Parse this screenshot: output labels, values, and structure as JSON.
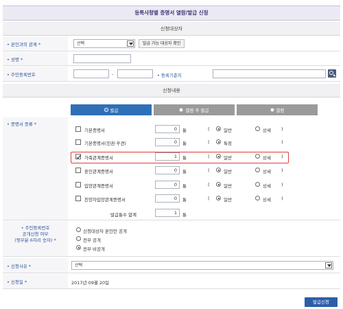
{
  "title": "등록사항별 증명서 열람/발급 신청",
  "sections": {
    "applicant_header": "신청대상자",
    "content_header": "신청내용"
  },
  "applicant": {
    "relation_label": "• 본인과의 관계 *",
    "relation_value": "선택",
    "check_button": "발급 가능 대상자 확인",
    "name_label": "• 성명 *",
    "rrn_label": "• 주민등록번호",
    "rrn_dash": "-",
    "reg_base_label": "• 등록기준지"
  },
  "tabs": [
    {
      "label": "발급",
      "selected": true
    },
    {
      "label": "열람 후 발급",
      "selected": false
    },
    {
      "label": "열람",
      "selected": false
    }
  ],
  "cert_label": "• 증명서 종류 *",
  "certs": [
    {
      "name": "기본증명서",
      "checked": false,
      "qty": "0",
      "unit": "통",
      "open": "(",
      "r1": "일반",
      "r2": "상세",
      "close": ")",
      "r1_on": true
    },
    {
      "name": "기본증명서(친권·후견)",
      "checked": false,
      "qty": "0",
      "unit": "통",
      "open": "(",
      "r1": "특정",
      "r2": "",
      "close": ")",
      "r1_on": true
    },
    {
      "name": "가족관계증명서",
      "checked": true,
      "qty": "1",
      "unit": "통",
      "open": "(",
      "r1": "일반",
      "r2": "상세",
      "close": ")",
      "r1_on": true
    },
    {
      "name": "혼인관계증명서",
      "checked": false,
      "qty": "0",
      "unit": "통",
      "open": "(",
      "r1": "일반",
      "r2": "상세",
      "close": ")",
      "r1_on": true
    },
    {
      "name": "입양관계증명서",
      "checked": false,
      "qty": "0",
      "unit": "통",
      "open": "(",
      "r1": "일반",
      "r2": "상세",
      "close": ")",
      "r1_on": true
    },
    {
      "name": "친양자입양관계증명서",
      "checked": false,
      "qty": "0",
      "unit": "통",
      "open": "(",
      "r1": "일반",
      "r2": "상세",
      "close": ")",
      "r1_on": true
    }
  ],
  "total_label": "발급통수 합계",
  "total_qty": "1",
  "total_unit": "통",
  "disclosure": {
    "label_line1": "• 주민등록번호",
    "label_line2": "공개신청 여부",
    "label_line3": "(뒷부분 6자리 숫자) *",
    "options": [
      "신청대상자 본인만 공개",
      "전부 공개",
      "전부 비공개"
    ],
    "selected_index": 2
  },
  "reason": {
    "label": "• 신청사유 *",
    "value": "선택"
  },
  "date": {
    "label": "• 신청일 *",
    "value": "2017년 09월 20일"
  },
  "submit_label": "발급신청",
  "colors": {
    "accent": "#2c5ea8",
    "tab_active": "#2f6fb6",
    "tab_inactive": "#9a9a9a",
    "highlight": "#e23a3a"
  }
}
